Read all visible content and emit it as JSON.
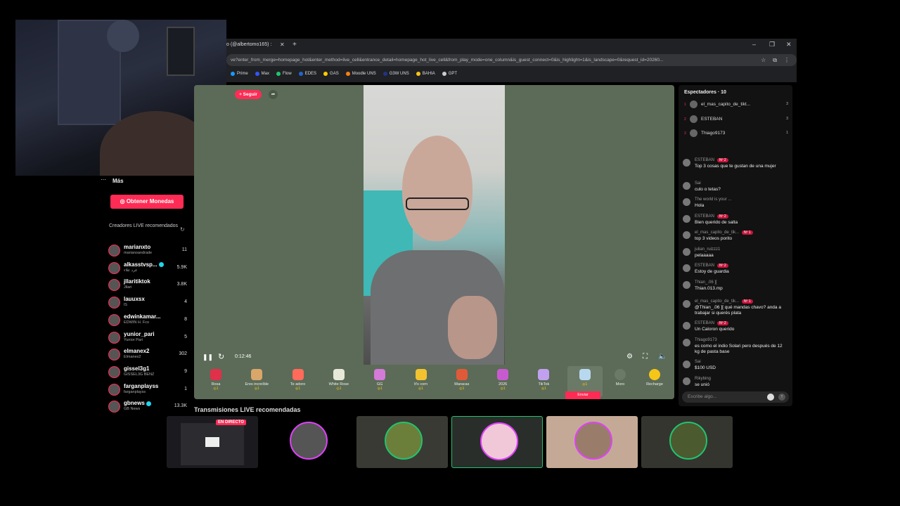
{
  "browser": {
    "tab_title": "o (@albertomo165) :",
    "url": "ve?enter_from_merge=homepage_hot&enter_method=live_cell&entrance_detail=homepage_hot_live_cell&from_play_mode=one_column&is_guest_connect=0&is_highlight=1&is_landscape=0&request_id=20260...",
    "bookmarks": [
      {
        "label": "Prime",
        "color": "#1a98ff"
      },
      {
        "label": "Max",
        "color": "#3355ff"
      },
      {
        "label": "Flow",
        "color": "#1fc56e"
      },
      {
        "label": "EDES",
        "color": "#2266cc"
      },
      {
        "label": "GAS",
        "color": "#ffcc00"
      },
      {
        "label": "Moodle UNS",
        "color": "#f98012"
      },
      {
        "label": "G3W UNS",
        "color": "#223388"
      },
      {
        "label": "BAHIA",
        "color": "#f5c518"
      },
      {
        "label": "GPT",
        "color": "#cccccc"
      }
    ]
  },
  "sidebar": {
    "more_label": "Más",
    "coins_button": "Obtener Monedas",
    "recommended_title": "Creadores LIVE recomendados",
    "creators": [
      {
        "name": "marianxto",
        "sub": "marianoandrade",
        "count": "11",
        "verified": false
      },
      {
        "name": "alkasstvsp...",
        "sub": "غرد علاء",
        "count": "5.9K",
        "verified": true
      },
      {
        "name": "jllaritiktok",
        "sub": "Jilari",
        "count": "3.8K",
        "verified": false
      },
      {
        "name": "lauuxsx",
        "sub": "lS",
        "count": "4",
        "verified": false
      },
      {
        "name": "edwinkamar...",
        "sub": "EDWIN H. Fco",
        "count": "8",
        "verified": false
      },
      {
        "name": "yunior_pari",
        "sub": "Yunior Pari",
        "count": "5",
        "verified": false
      },
      {
        "name": "elmanex2",
        "sub": "Elmanex2",
        "count": "302",
        "verified": false
      },
      {
        "name": "gissel3g1",
        "sub": "GISSEL3G BENZ",
        "count": "9",
        "verified": false
      },
      {
        "name": "farganplayss",
        "sub": "farganplayss",
        "count": "1",
        "verified": false
      },
      {
        "name": "gbnews",
        "sub": "GB News",
        "count": "13.3K",
        "verified": true
      }
    ]
  },
  "video": {
    "follow_button": "+ Seguir",
    "timer": "0:12:46",
    "gifts": [
      {
        "label": "Rosa",
        "price": "1",
        "color": "#e0304a"
      },
      {
        "label": "Eres increíble",
        "price": "1",
        "color": "#d9a76a"
      },
      {
        "label": "Te adoro",
        "price": "1",
        "color": "#ff6a5a"
      },
      {
        "label": "White Rose",
        "price": "1",
        "color": "#e8e8d8"
      },
      {
        "label": "GG",
        "price": "1",
        "color": "#d47ad8"
      },
      {
        "label": "It's corn",
        "price": "1",
        "color": "#f2c230"
      },
      {
        "label": "Maracas",
        "price": "1",
        "color": "#e05a3a"
      },
      {
        "label": "2026",
        "price": "1",
        "color": "#c85ad0"
      },
      {
        "label": "TikTok",
        "price": "1",
        "color": "#c1a0f0"
      },
      {
        "label": "",
        "price": "1",
        "color": "#b8d8f0"
      }
    ],
    "send_label": "Enviar",
    "more_label": "Moro",
    "recharge_label": "Recharge"
  },
  "viewers": {
    "title": "Espectadores · 10",
    "list": [
      {
        "rank": "1",
        "name": "el_mas_capito_de_tikt...",
        "score": "3"
      },
      {
        "rank": "2",
        "name": "ESTEBAN",
        "score": "3"
      },
      {
        "rank": "3",
        "name": "Thiago9173",
        "score": "1"
      }
    ]
  },
  "chat": {
    "messages": [
      {
        "user": "ESTEBAN",
        "badge": "Nº 2",
        "text": "Top 3 cosas que te gustan de una mujer"
      },
      {
        "user": "Sai",
        "badge": "",
        "text": "culo o tetas?"
      },
      {
        "user": "The world is your ...",
        "badge": "",
        "text": "Hola"
      },
      {
        "user": "ESTEBAN",
        "badge": "Nº 2",
        "text": "Bien querido de salta"
      },
      {
        "user": "el_mas_capito_de_tik...",
        "badge": "Nº 1",
        "text": "top 3 videos porito"
      },
      {
        "user": "julian_ruizzz1",
        "badge": "",
        "text": "pelaaaaa"
      },
      {
        "user": "ESTEBAN",
        "badge": "Nº 2",
        "text": "Estoy de guardia"
      },
      {
        "user": "Thian_.06 ][",
        "badge": "",
        "text": "Thian.013.mp"
      },
      {
        "user": "el_mas_capito_de_tik...",
        "badge": "Nº 1",
        "text": "@Thian_.06 ][ qué mandas chavo? anda a trabajar si querés plata"
      },
      {
        "user": "ESTEBAN",
        "badge": "Nº 2",
        "text": "Un Caloron querido"
      },
      {
        "user": "Thiago9173",
        "badge": "",
        "text": "es como el indio Solari pero después de 12 kg de pasta base"
      },
      {
        "user": "Sai",
        "badge": "",
        "text": "$100 USD"
      },
      {
        "user": "Rikybing",
        "badge": "",
        "text": "se unió"
      }
    ],
    "placeholder": "Escribe algo..."
  },
  "recommended_live": {
    "title": "Transmisiones LIVE recomendadas",
    "live_badge": "EN DIRECTO"
  }
}
